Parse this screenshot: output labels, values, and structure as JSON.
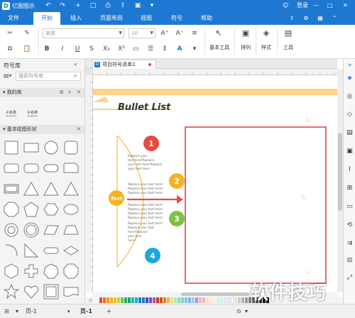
{
  "app": {
    "name": "亿图图示"
  },
  "titlebar": {
    "login_label": "登录",
    "quick_access": [
      "↶",
      "↷",
      "+",
      "□",
      "⎙",
      "⇪",
      "▣",
      "▾"
    ]
  },
  "menu": {
    "tabs": [
      "文件",
      "开始",
      "插入",
      "页面布局",
      "视图",
      "符号",
      "帮助"
    ],
    "active_index": 1
  },
  "ribbon": {
    "font_name": "宋体",
    "font_size": "10",
    "groups": {
      "basic_tools": "基本工具",
      "arrange": "排列",
      "style": "样式",
      "tools": "工具"
    }
  },
  "left_panel": {
    "title": "符号库",
    "search_placeholder": "搜索符号库",
    "my_library": {
      "title": "我的库",
      "items": [
        "子名称",
        "子名称"
      ]
    },
    "basic_shapes": {
      "title": "基本绘图形状"
    }
  },
  "document": {
    "tab_label": "项目符号清单2"
  },
  "canvas": {
    "heading": "Bullet List",
    "center_label": "Text",
    "bullets": [
      {
        "number": "1",
        "color": "#e84a3f",
        "text": [
          "Replace your",
          "text here!Replace",
          "your text here!Replace",
          "your text here!"
        ]
      },
      {
        "number": "2",
        "color": "#f6b223",
        "text": [
          "Replace your text here!",
          "Replace your text here!",
          "Replace your text here!"
        ]
      },
      {
        "number": "3",
        "color": "#7dc142",
        "text": [
          "Replace your text here!",
          "Replace your text here!",
          "Replace your text here!",
          "Replace your text here!"
        ]
      },
      {
        "number": "4",
        "color": "#1ba8e0",
        "text": [
          "Replace your text here!",
          "Replace your text",
          "here!Replace",
          "your text",
          "here!"
        ]
      }
    ]
  },
  "status_bar": {
    "page_tab": "页-1",
    "page_tab_active": "页-1",
    "add_page": "+"
  },
  "watermark": {
    "text": "软件技巧"
  },
  "colors": {
    "brand": "#1e78d2",
    "frame": "#e03a3a",
    "accent_bar": "#fbd38d"
  },
  "icons": [
    "undo-icon",
    "redo-icon",
    "add-icon",
    "folder-icon",
    "save-icon",
    "share-icon",
    "more-icon",
    "cut-icon",
    "brush-icon",
    "paste-icon",
    "bold-icon",
    "italic-icon",
    "underline-icon",
    "subscript-icon",
    "superscript-icon",
    "font-grow-icon",
    "font-shrink-icon",
    "align-icon",
    "pointer-icon",
    "arrange-icon",
    "fill-icon",
    "tools-icon",
    "search-icon",
    "collapse-icon",
    "shape-icon"
  ]
}
